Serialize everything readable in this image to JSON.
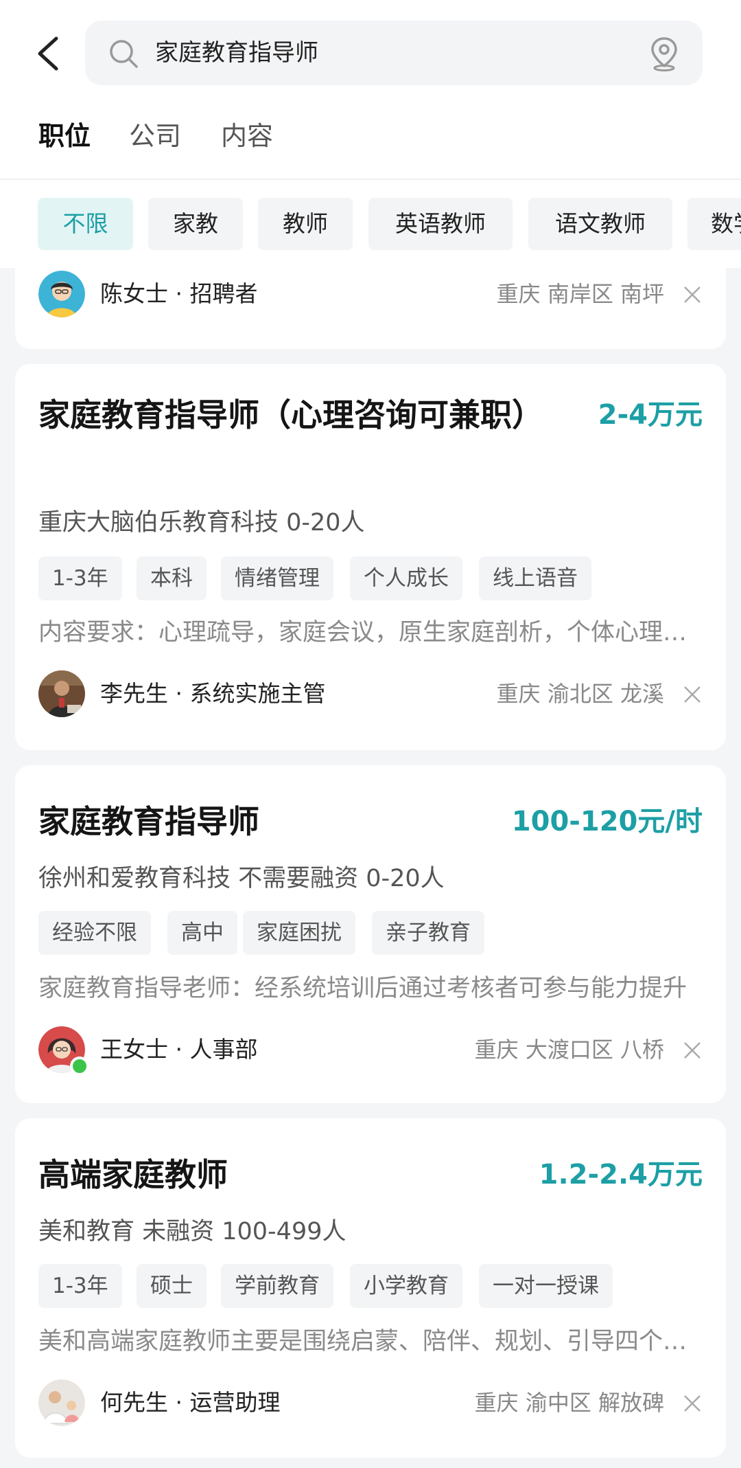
{
  "search": {
    "query": "家庭教育指导师"
  },
  "tabs": [
    {
      "label": "职位",
      "active": true
    },
    {
      "label": "公司",
      "active": false
    },
    {
      "label": "内容",
      "active": false
    }
  ],
  "filters": [
    {
      "label": "不限",
      "active": true
    },
    {
      "label": "家教",
      "active": false
    },
    {
      "label": "教师",
      "active": false
    },
    {
      "label": "英语教师",
      "active": false
    },
    {
      "label": "语文教师",
      "active": false
    },
    {
      "label": "数学",
      "active": false
    }
  ],
  "colors": {
    "accent": "#1c9fa5",
    "chip_active_bg": "#e3f4f4",
    "online": "#3cc44a"
  },
  "partial_card": {
    "recruiter": "陈女士 · 招聘者",
    "location": "重庆  南岸区  南坪"
  },
  "jobs": [
    {
      "title": "家庭教育指导师（心理咨询可兼职）",
      "salary": "2-4万元",
      "company": "重庆大脑伯乐教育科技  0-20人",
      "tags": [
        "1-3年",
        "本科",
        "情绪管理",
        "个人成长",
        "线上语音"
      ],
      "description": "内容要求：心理疏导，家庭会议，原生家庭剖析，个体心理咨询",
      "recruiter": "李先生 · 系统实施主管",
      "location": "重庆  渝北区  龙溪"
    },
    {
      "title": "家庭教育指导师",
      "salary": "100-120元/时",
      "company": "徐州和爱教育科技  不需要融资  0-20人",
      "tags": [
        "经验不限",
        "高中",
        "家庭困扰",
        "亲子教育"
      ],
      "description": "家庭教育指导老师：经系统培训后通过考核者可参与能力提升",
      "recruiter": "王女士 · 人事部",
      "location": "重庆  大渡口区  八桥"
    },
    {
      "title": "高端家庭教师",
      "salary": "1.2-2.4万元",
      "company": "美和教育  未融资  100-499人",
      "tags": [
        "1-3年",
        "硕士",
        "学前教育",
        "小学教育",
        "一对一授课"
      ],
      "description": "美和高端家庭教师主要是围绕启蒙、陪伴、规划、引导四个方面",
      "recruiter": "何先生 · 运营助理",
      "location": "重庆  渝中区  解放碑"
    }
  ]
}
